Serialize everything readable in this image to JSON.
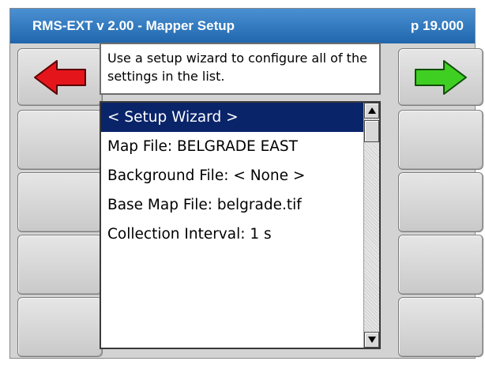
{
  "window": {
    "title": "RMS-EXT v 2.00 - Mapper Setup",
    "page_number": "p 19.000"
  },
  "navigation": {
    "back_icon": "left-arrow-icon",
    "back_color": "#e4161c",
    "forward_icon": "right-arrow-icon",
    "forward_color": "#3fcf22"
  },
  "description": "Use a setup wizard to configure all of the settings in the list.",
  "settings_list": {
    "items": [
      "< Setup Wizard >",
      "Map File: BELGRADE EAST",
      "Background File: < None >",
      "Base Map File: belgrade.tif",
      "Collection Interval: 1 s"
    ],
    "selected_index": 0
  },
  "colors": {
    "title_bar": "#2a74bd",
    "selection": "#0a246a",
    "panel": "#d3d3d3"
  }
}
